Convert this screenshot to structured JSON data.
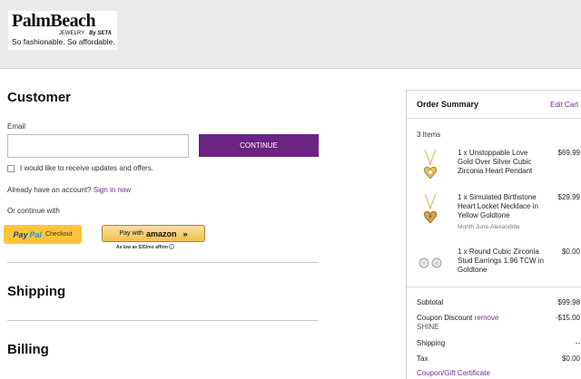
{
  "brand": {
    "name": "PalmBeach",
    "sub": "JEWELRY",
    "by": "By SETA",
    "tagline": "So fashionable. So affordable."
  },
  "customer": {
    "heading": "Customer",
    "email_label": "Email",
    "email_value": "",
    "continue_label": "CONTINUE",
    "updates_label": "I would like to receive updates and offers.",
    "account_prompt": "Already have an account?",
    "sign_in_label": "Sign in now",
    "or_continue": "Or continue with",
    "paypal": {
      "part1": "Pay",
      "part2": "Pal",
      "label": "Checkout"
    },
    "amazon": {
      "prefix": "Pay with",
      "brand": "amazon",
      "arrows": "»"
    },
    "affirm_text": "As low as $35/mo",
    "affirm_brand": "affirm",
    "affirm_icon": "info-icon"
  },
  "sections": {
    "shipping": "Shipping",
    "billing": "Billing"
  },
  "summary": {
    "heading": "Order Summary",
    "edit_cart_label": "Edit Cart",
    "items_count": "3 Items",
    "items": [
      {
        "desc": "1 x Unstoppable Love Gold Over Silver Cubic Zirconia Heart Pendant",
        "price": "$69.99",
        "option": "",
        "icon": "heart-pendant-necklace-icon"
      },
      {
        "desc": "1 x Simulated Birthstone Heart Locket Necklace in Yellow Goldtone",
        "price": "$29.99",
        "option": "Month June-Alexandrite",
        "icon": "heart-locket-necklace-icon"
      },
      {
        "desc": "1 x Round Cubic Zirconia Stud Earrings 1.96 TCW in Goldtone",
        "price": "$0.00",
        "option": "",
        "icon": "stud-earrings-icon"
      }
    ],
    "subtotal_label": "Subtotal",
    "subtotal_value": "$99.98",
    "coupon_label": "Coupon Discount",
    "coupon_remove": "remove",
    "coupon_code": "SHINE",
    "coupon_value": "-$15.00",
    "shipping_label": "Shipping",
    "shipping_value": "--",
    "tax_label": "Tax",
    "tax_value": "$0.00",
    "coupon_link": "Coupon/Gift Certificate"
  },
  "colors": {
    "accent": "#6b2384",
    "link": "#7a2c96",
    "paypal_yellow": "#ffc439",
    "amazon_gold": "#f0c14b",
    "header_bg": "#ebebeb"
  }
}
